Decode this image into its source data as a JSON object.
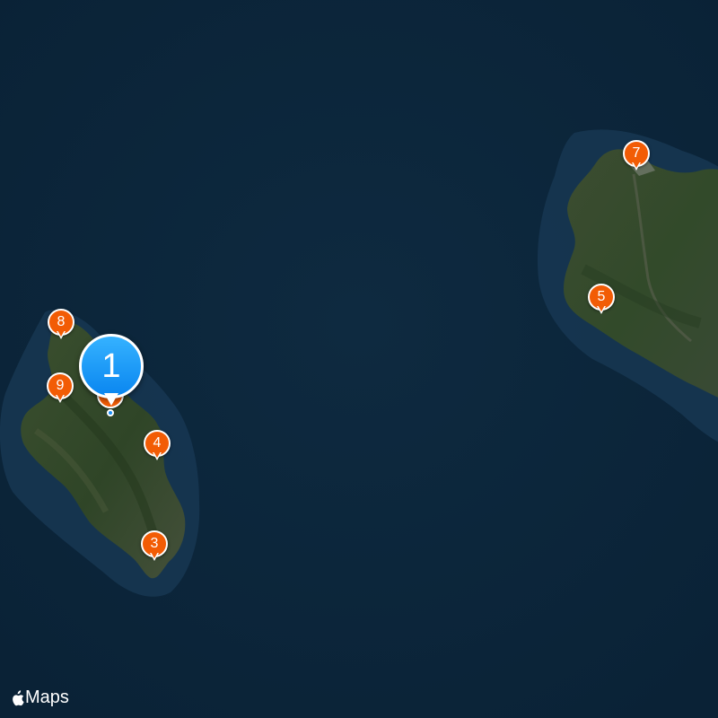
{
  "map": {
    "colors": {
      "sea": "#0b2438",
      "shallow_water": "#1e4059",
      "land": "#34492a",
      "land_dark": "#263b22",
      "pin_orange": "#f25c05",
      "pin_blue": "#1a8ef5"
    },
    "markers": [
      {
        "label": "1",
        "kind": "selected-cluster"
      },
      {
        "label": "3",
        "kind": "place"
      },
      {
        "label": "4",
        "kind": "place"
      },
      {
        "label": "5",
        "kind": "place"
      },
      {
        "label": "7",
        "kind": "place"
      },
      {
        "label": "8",
        "kind": "place"
      },
      {
        "label": "9",
        "kind": "place"
      }
    ],
    "attribution": {
      "icon": "apple-logo-icon",
      "text": "Maps"
    }
  }
}
